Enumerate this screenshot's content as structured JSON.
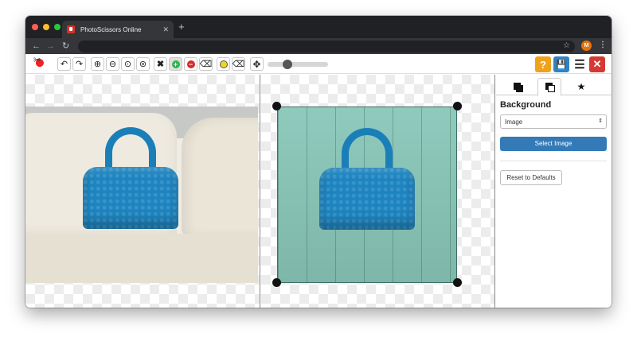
{
  "browser": {
    "tab_title": "PhotoScissors Online",
    "tab_close": "✕",
    "new_tab": "+",
    "back": "←",
    "forward": "→",
    "reload": "↻",
    "bookmark": "☆",
    "profile_initial": "M",
    "menu": "⋮"
  },
  "toolbar": {
    "undo": "↶",
    "redo": "↷",
    "zoom_in": "⊕",
    "zoom_out": "⊖",
    "zoom_actual": "⊙",
    "zoom_fit": "⊚",
    "clear": "✖",
    "keep_marker": "+",
    "remove_marker": "−",
    "eraser": "⌫",
    "eraser_alt": "⌫",
    "move": "✥",
    "brush_size_percent": 30,
    "help": "?",
    "save": "💾",
    "menu": "☰",
    "close": "✕",
    "colors": {
      "keep_green": "#2fb54a",
      "remove_red": "#d42b2b",
      "yellow": "#f1d41c",
      "help_orange": "#f0a21c",
      "save_blue": "#2f82c6",
      "close_red": "#d33a32"
    }
  },
  "panel": {
    "tab_star": "★",
    "background_heading": "Background",
    "background_type": "Image",
    "background_type_arrow": "⇕",
    "select_image_label": "Select Image",
    "reset_label": "Reset to Defaults"
  }
}
